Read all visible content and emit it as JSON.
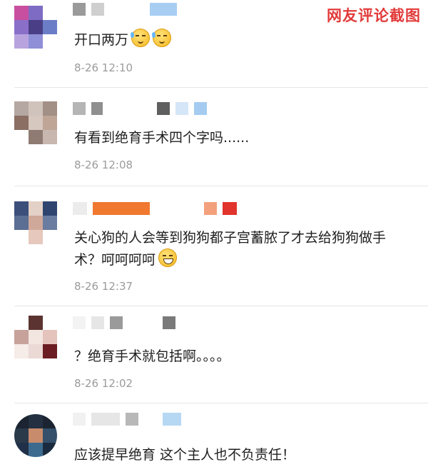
{
  "watermark": "网友评论截图",
  "comments": [
    {
      "text": "开口两万",
      "emoji": [
        "sweat-smile-icon",
        "sweat-smile-icon"
      ],
      "time": "8-26 12:10"
    },
    {
      "text": "有看到绝育手术四个字吗......",
      "time": "8-26 12:08"
    },
    {
      "text": "关心狗的人会等到狗狗都子宫蓄脓了才去给狗狗做手术？呵呵呵呵",
      "emoji": [
        "grin-icon"
      ],
      "time": "8-26 12:37"
    },
    {
      "text": "？绝育手术就包括啊。。。。",
      "time": "8-26 12:02"
    },
    {
      "text": "应该提早绝育 这个主人也不负责任！"
    }
  ],
  "colors": {
    "watermark": "#e23b3b",
    "time": "#9b9b9b",
    "text": "#1f1f1f",
    "divider": "#e6e6e6"
  }
}
